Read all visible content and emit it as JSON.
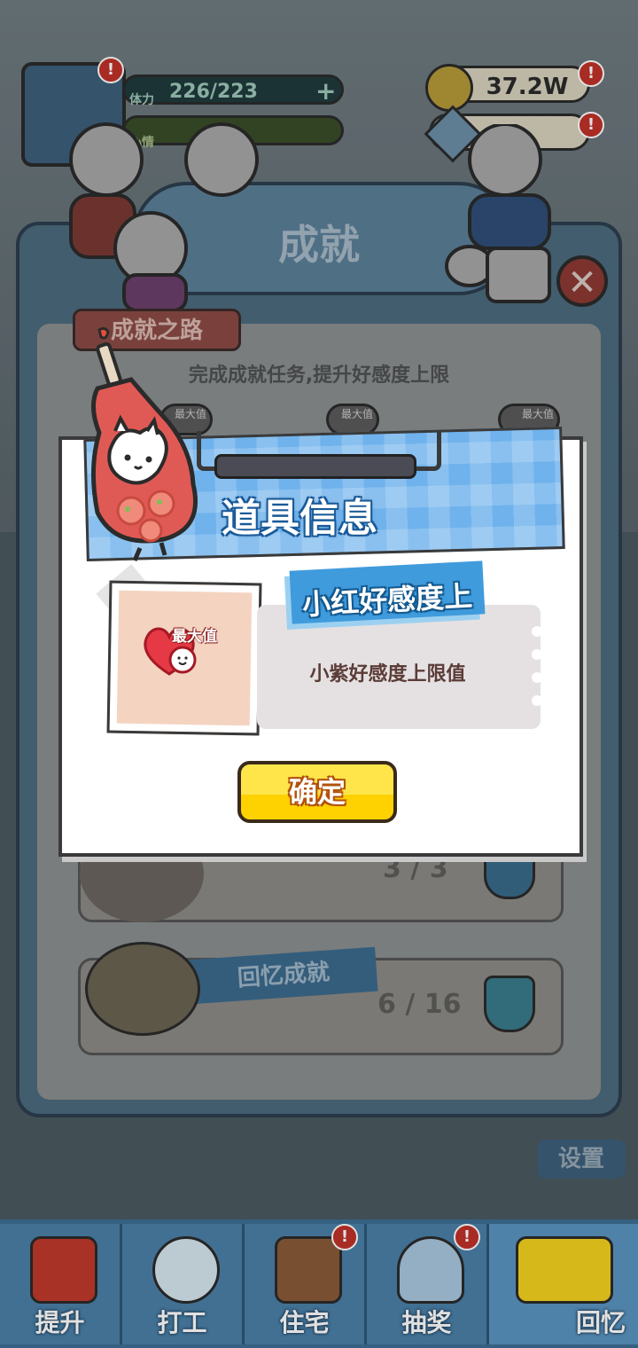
{
  "hud": {
    "stamina_label": "体力",
    "stamina_value": "226/223",
    "mood_label": "心情",
    "coins": "37.2W",
    "alert_mark": "!"
  },
  "achievement_panel": {
    "title": "成就",
    "road_label": "成就之路",
    "road_desc": "完成成就任务,提升好感度上限",
    "max_tag": "最大值",
    "row1_count": "3 / 3",
    "memory_label": "回忆成就",
    "memory_count": "6 / 16",
    "close_symbol": "✕"
  },
  "settings_label": "设置",
  "bottom_nav": [
    {
      "label": "提升"
    },
    {
      "label": "打工"
    },
    {
      "label": "住宅"
    },
    {
      "label": "抽奖"
    },
    {
      "label": "回忆"
    }
  ],
  "modal": {
    "title": "道具信息",
    "item_name": "小红好感度上",
    "item_tag": "最大值",
    "description": "小紫好感度上限值",
    "confirm_label": "确定"
  },
  "colors": {
    "header_blue": "#6fb2ec",
    "ribbon_blue": "#3f9bdc",
    "confirm_yellow": "#fdd200",
    "card_peach": "#f4d4c1",
    "heart_red": "#e63946"
  }
}
